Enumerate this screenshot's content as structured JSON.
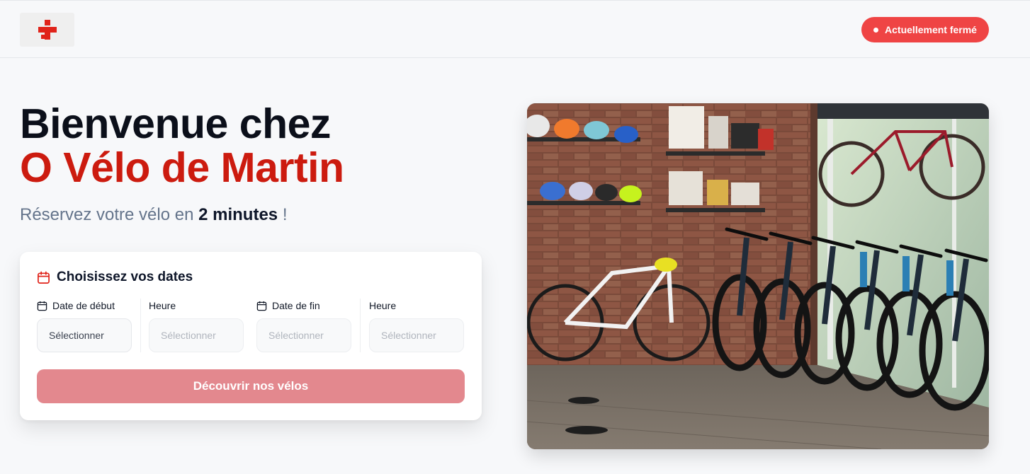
{
  "header": {
    "logo": "cross-logo",
    "status_label": "Actuellement fermé",
    "status_color": "#ef4444"
  },
  "hero": {
    "title_line1": "Bienvenue chez",
    "title_line2": "O Vélo de Martin",
    "tagline_prefix": "Réservez votre vélo en",
    "tagline_emphasis": "2 minutes",
    "tagline_suffix": "!"
  },
  "booking": {
    "title": "Choisissez vos dates",
    "fields": [
      {
        "label": "Date de début",
        "placeholder": "Sélectionner",
        "icon": "calendar-icon"
      },
      {
        "label": "Heure",
        "placeholder": "Sélectionner"
      },
      {
        "label": "Date de fin",
        "placeholder": "Sélectionner",
        "icon": "calendar-icon"
      },
      {
        "label": "Heure",
        "placeholder": "Sélectionner"
      }
    ],
    "cta_label": "Découvrir nos vélos"
  },
  "colors": {
    "brand_red": "#cc1b0f",
    "cta_disabled": "#e3888e"
  },
  "photo": {
    "subject": "bike-shop-interior"
  }
}
